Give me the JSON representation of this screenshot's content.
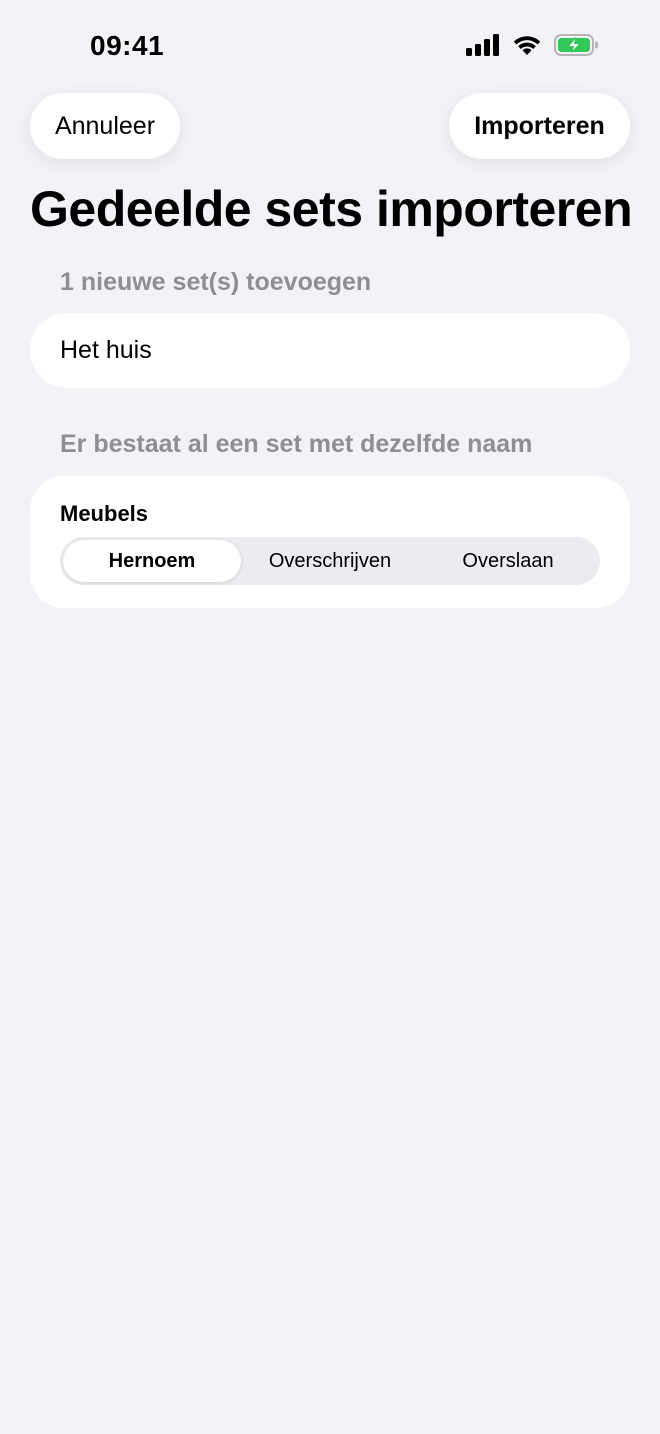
{
  "status_bar": {
    "time": "09:41",
    "icons": [
      "signal-icon",
      "wifi-icon",
      "battery-charging-icon"
    ],
    "battery_color": "#34C759"
  },
  "nav": {
    "cancel_label": "Annuleer",
    "import_label": "Importeren"
  },
  "title": "Gedeelde sets importeren",
  "new_sets": {
    "header": "1 nieuwe set(s) toevoegen",
    "items": [
      {
        "name": "Het huis"
      }
    ]
  },
  "conflicts": {
    "header": "Er bestaat al een set met dezelfde naam",
    "items": [
      {
        "name": "Meubels",
        "options": [
          "Hernoem",
          "Overschrijven",
          "Overslaan"
        ],
        "selected": "Hernoem"
      }
    ]
  },
  "colors": {
    "background": "#F2F2F7",
    "card": "#FFFFFF",
    "secondary_text": "#8E8E93",
    "segment_track": "#EBEBF0"
  }
}
